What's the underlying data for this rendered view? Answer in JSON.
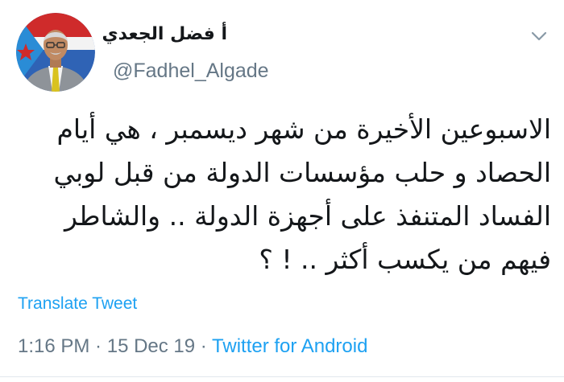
{
  "tweet": {
    "author": {
      "display_name": "أ فضل الجعدي",
      "handle": "@Fadhel_Algade"
    },
    "menu_icon": "chevron-down-icon",
    "text_lines": [
      "الاسبوعين الأخيرة من شهر ديسمبر ، هي أيام",
      "الحصاد و حلب مؤسسات الدولة من قبل لوبي",
      "الفساد المتنفذ على أجهزة الدولة .. والشاطر",
      "فيهم من يكسب أكثر .. ! ؟"
    ],
    "translate_label": "Translate Tweet",
    "time": "1:16 PM",
    "date": "15 Dec 19",
    "separator": " · ",
    "source": "Twitter for Android"
  },
  "colors": {
    "text": "#14171a",
    "secondary": "#657786",
    "link": "#1da1f2"
  }
}
